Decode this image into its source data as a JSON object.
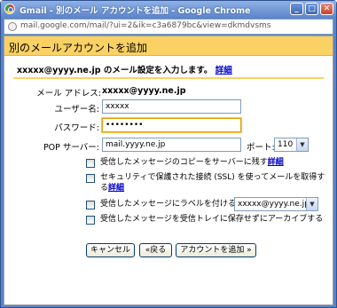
{
  "window": {
    "title": "Gmail - 別のメール アカウントを追加 - Google Chrome",
    "controls": [
      "_",
      "□",
      "✕"
    ]
  },
  "addressbar": {
    "url": "mail.google.com/mail/?ui=2&ik=c3a6879bc&view=dkmdvsms"
  },
  "page": {
    "title": "別のメールアカウントを追加",
    "instruction": "xxxxx@yyyy.ne.jp のメール設定を入力します。",
    "instruction_link": "詳細",
    "colors": {
      "header_bg": "#fad163",
      "link": "#0000cc",
      "titlebar": "#5d86cb"
    }
  },
  "form": {
    "email_label": "メール アドレス:",
    "email_value": "xxxxx@yyyy.ne.jp",
    "username_label": "ユーザー名:",
    "username_value": "xxxxx",
    "password_label": "パスワード:",
    "password_value": "••••••••",
    "pop_label": "POP サーバー:",
    "pop_value": "mail.yyyy.ne.jp",
    "port_label": "ポート:",
    "port_value": "110",
    "options": [
      {
        "text": "受信したメッセージのコピーをサーバーに残す",
        "link": "詳細"
      },
      {
        "text": "セキュリティで保護された接続 (SSL) を使ってメールを取得す",
        "text2": "る",
        "link": "詳細"
      },
      {
        "text": "受信したメッセージにラベルを付ける:",
        "select_value": "xxxxx@yyyy.ne.jp"
      },
      {
        "text": "受信したメッセージを受信トレイに保存せずにアーカイブする"
      }
    ]
  },
  "buttons": {
    "cancel": "キャンセル",
    "back": "«戻る",
    "add": "アカウントを追加 »"
  }
}
